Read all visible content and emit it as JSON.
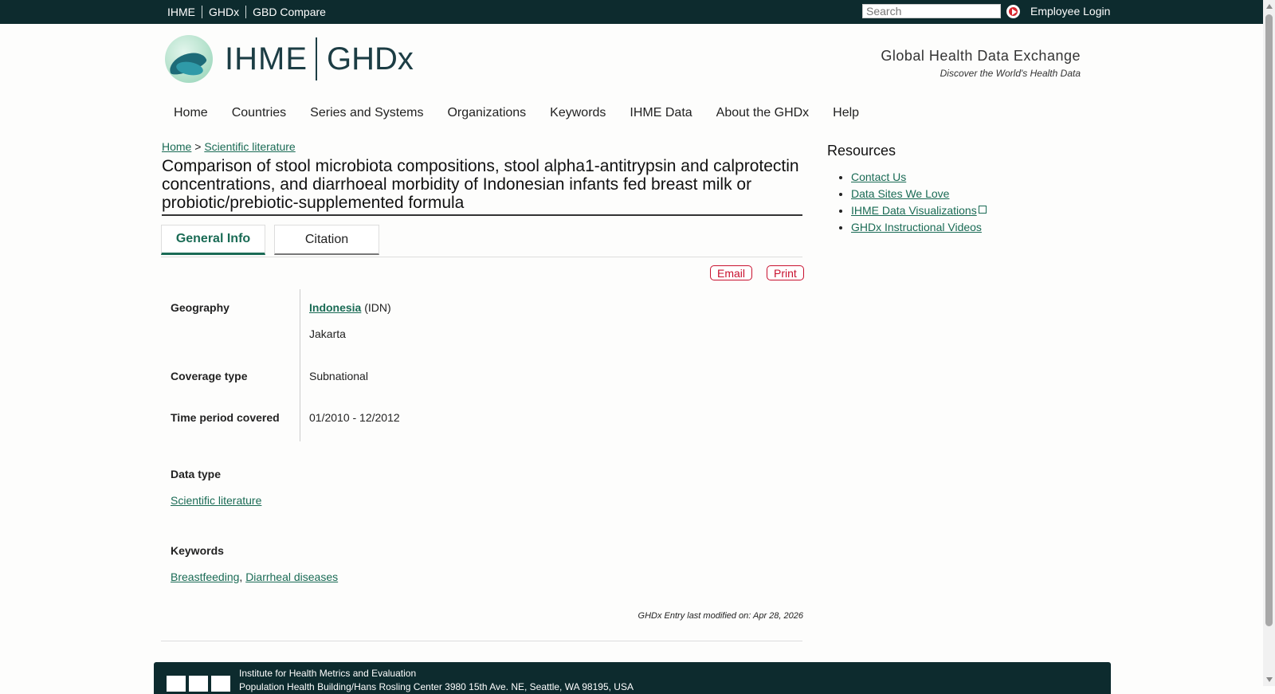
{
  "topbar": {
    "links": [
      "IHME",
      "GHDx",
      "GBD Compare"
    ],
    "search_placeholder": "Search",
    "employee_login": "Employee Login"
  },
  "header": {
    "logo_ihme": "IHME",
    "logo_ghdx": "GHDx",
    "tagline": "Global Health Data Exchange",
    "subtagline": "Discover the World's Health Data"
  },
  "nav": {
    "items": [
      "Home",
      "Countries",
      "Series and Systems",
      "Organizations",
      "Keywords",
      "IHME Data",
      "About the GHDx",
      "Help"
    ]
  },
  "breadcrumb": {
    "home": "Home",
    "sep": ">",
    "current": "Scientific literature"
  },
  "record": {
    "title": "Comparison of stool microbiota compositions, stool alpha1-antitrypsin and calprotectin concentrations, and diarrhoeal morbidity of Indonesian infants fed breast milk or probiotic/prebiotic-supplemented formula",
    "tabs": [
      "General Info",
      "Citation"
    ],
    "actions": {
      "email": "Email",
      "print": "Print"
    },
    "geography_label": "Geography",
    "geography_country": "Indonesia",
    "geography_code": "(IDN)",
    "geography_city": "Jakarta",
    "coverage_label": "Coverage type",
    "coverage_value": "Subnational",
    "time_label": "Time period covered",
    "time_value": "01/2010 - 12/2012",
    "datatype_label": "Data type",
    "datatype_value": "Scientific literature",
    "keywords_label": "Keywords",
    "keywords": [
      "Breastfeeding",
      "Diarrheal diseases"
    ],
    "keyword_sep": ",",
    "modified": "GHDx Entry last modified on: Apr 28, 2026"
  },
  "sidebar": {
    "title": "Resources",
    "items": [
      "Contact Us",
      "Data Sites We Love",
      "IHME Data Visualizations",
      "GHDx Instructional Videos"
    ]
  },
  "footer": {
    "org": "Institute for Health Metrics and Evaluation",
    "address": "Population Health Building/Hans Rosling Center 3980 15th Ave. NE, Seattle, WA 98195, USA"
  },
  "colors": {
    "topbar": "#0d2b2e",
    "link": "#1a6b55",
    "action_red": "#c8102e"
  }
}
